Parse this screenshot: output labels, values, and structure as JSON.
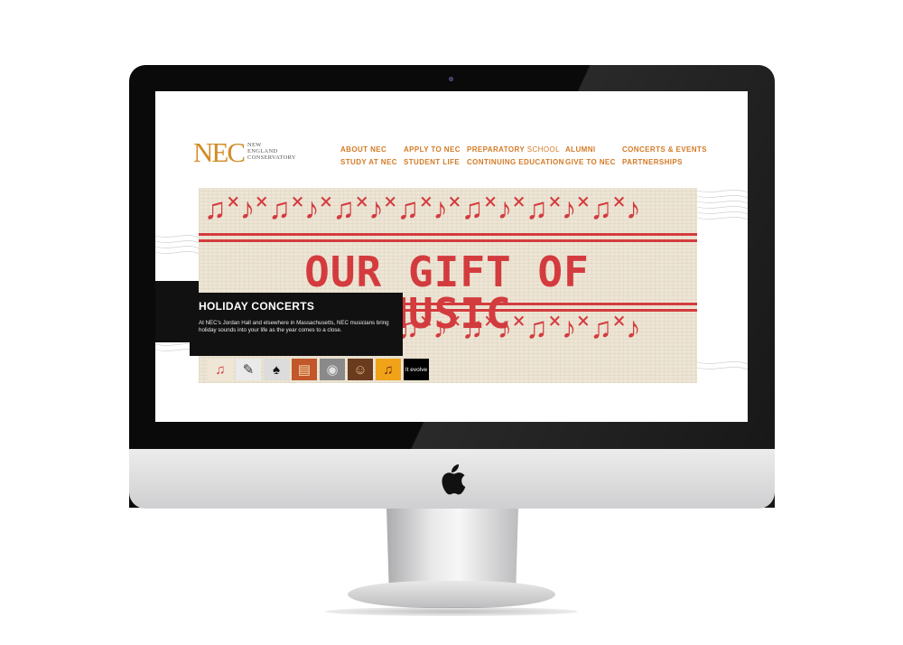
{
  "site": {
    "logo_mark": "NEC",
    "logo_lines": [
      "NEW",
      "ENGLAND",
      "CONSERVATORY"
    ]
  },
  "nav": {
    "items": [
      {
        "label": "ABOUT NEC"
      },
      {
        "label": "APPLY TO NEC"
      },
      {
        "label_bold": "PREPARATORY",
        "label_lite": " SCHOOL"
      },
      {
        "label": "ALUMNI"
      },
      {
        "label": "CONCERTS & EVENTS"
      },
      {
        "label": "STUDY AT NEC"
      },
      {
        "label": "STUDENT LIFE"
      },
      {
        "label": "CONTINUING EDUCATION"
      },
      {
        "label": "GIVE TO NEC"
      },
      {
        "label": "PARTNERSHIPS"
      }
    ]
  },
  "banner": {
    "title": "OUR GIFT OF MUSIC",
    "notes_pattern": "♫˟♪˟♫˟♪˟♫˟♪˟♫˟♪˟♫˟♪˟♫˟♪˟♫˟♪",
    "colors": {
      "knit": "#ede5d5",
      "red": "#d33b3e"
    }
  },
  "feature": {
    "heading": "HOLIDAY CONCERTS",
    "body": "At NEC's Jordan Hall and elsewhere in Massachusetts, NEC musicians bring holiday sounds into your life as the year comes to a close."
  },
  "thumbnails": [
    {
      "icon": "music-note-icon",
      "glyph": "♫"
    },
    {
      "icon": "instrument-icon",
      "glyph": "✎"
    },
    {
      "icon": "piano-icon",
      "glyph": "♠"
    },
    {
      "icon": "poster-icon",
      "glyph": "▤"
    },
    {
      "icon": "portrait-icon",
      "glyph": "◉"
    },
    {
      "icon": "performer-icon",
      "glyph": "☺"
    },
    {
      "icon": "note-tile-icon",
      "glyph": "♫"
    },
    {
      "icon": "text-tile-icon",
      "label": "It evolve"
    }
  ],
  "colors": {
    "accent": "#d37a25",
    "brand": "#d28c25"
  }
}
